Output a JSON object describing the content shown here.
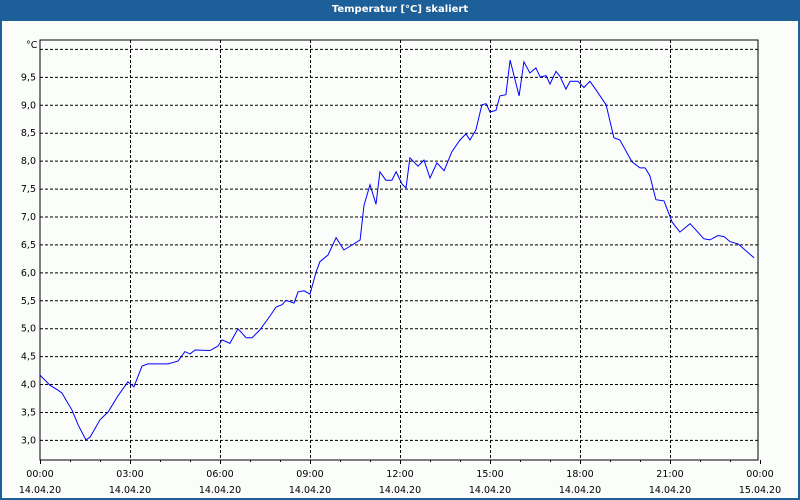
{
  "window": {
    "title": "Temperatur [°C] skaliert"
  },
  "colors": {
    "titlebar": "#1d5f98",
    "line": "#0000ff",
    "grid": "#000000"
  },
  "chart_data": {
    "type": "line",
    "title": "Temperatur [°C] skaliert",
    "ylabel": "°C",
    "xlabel": "",
    "ylim": [
      2.64,
      10.16
    ],
    "xlim_hours": [
      0,
      24
    ],
    "y_gridlines": [
      3.0,
      3.5,
      4.0,
      4.5,
      5.0,
      5.5,
      6.0,
      6.5,
      7.0,
      7.5,
      8.0,
      8.5,
      9.0,
      9.5,
      10.0
    ],
    "y_ticks": [
      "3,0",
      "3,5",
      "4,0",
      "4,5",
      "5,0",
      "5,5",
      "6,0",
      "6,5",
      "7,0",
      "7,5",
      "8,0",
      "8,5",
      "9,0",
      "9,5"
    ],
    "y_tick_values": [
      3.0,
      3.5,
      4.0,
      4.5,
      5.0,
      5.5,
      6.0,
      6.5,
      7.0,
      7.5,
      8.0,
      8.5,
      9.0,
      9.5
    ],
    "x_ticks": [
      {
        "hour": 0,
        "time": "00:00",
        "date": "14.04.20"
      },
      {
        "hour": 3,
        "time": "03:00",
        "date": "14.04.20"
      },
      {
        "hour": 6,
        "time": "06:00",
        "date": "14.04.20"
      },
      {
        "hour": 9,
        "time": "09:00",
        "date": "14.04.20"
      },
      {
        "hour": 12,
        "time": "12:00",
        "date": "14.04.20"
      },
      {
        "hour": 15,
        "time": "15:00",
        "date": "14.04.20"
      },
      {
        "hour": 18,
        "time": "18:00",
        "date": "14.04.20"
      },
      {
        "hour": 21,
        "time": "21:00",
        "date": "14.04.20"
      },
      {
        "hour": 24,
        "time": "00:00",
        "date": "15.04.20"
      }
    ],
    "grid": true,
    "series": [
      {
        "name": "Temperatur",
        "x_hours": [
          0,
          0.33,
          0.6,
          0.73,
          1.07,
          1.27,
          1.53,
          1.67,
          2.0,
          2.27,
          2.6,
          2.93,
          3.13,
          3.4,
          3.6,
          4.27,
          4.6,
          4.83,
          5.0,
          5.17,
          5.67,
          5.93,
          6.07,
          6.33,
          6.6,
          6.87,
          7.07,
          7.33,
          7.67,
          7.87,
          8.07,
          8.2,
          8.47,
          8.6,
          8.8,
          9.0,
          9.2,
          9.33,
          9.6,
          9.87,
          10.13,
          10.4,
          10.67,
          10.8,
          11.0,
          11.2,
          11.33,
          11.53,
          11.73,
          11.87,
          12.07,
          12.2,
          12.33,
          12.6,
          12.8,
          13.0,
          13.23,
          13.47,
          13.73,
          14.0,
          14.2,
          14.33,
          14.53,
          14.73,
          14.87,
          15.0,
          15.2,
          15.33,
          15.53,
          15.67,
          15.97,
          16.13,
          16.33,
          16.53,
          16.67,
          16.87,
          17.0,
          17.2,
          17.33,
          17.53,
          17.67,
          17.93,
          18.13,
          18.33,
          18.53,
          18.87,
          19.13,
          19.33,
          19.73,
          20.0,
          20.17,
          20.33,
          20.53,
          20.8,
          21.07,
          21.33,
          21.67,
          22.13,
          22.33,
          22.6,
          22.8,
          23.0,
          23.27,
          23.8
        ],
        "values": [
          4.16,
          3.98,
          3.89,
          3.84,
          3.53,
          3.27,
          3.0,
          3.05,
          3.36,
          3.5,
          3.79,
          4.04,
          3.95,
          4.32,
          4.36,
          4.36,
          4.41,
          4.58,
          4.54,
          4.61,
          4.6,
          4.68,
          4.79,
          4.73,
          4.99,
          4.83,
          4.83,
          4.97,
          5.22,
          5.38,
          5.42,
          5.5,
          5.45,
          5.65,
          5.67,
          5.61,
          6.0,
          6.19,
          6.31,
          6.62,
          6.4,
          6.49,
          6.58,
          7.2,
          7.57,
          7.22,
          7.8,
          7.65,
          7.65,
          7.8,
          7.58,
          7.51,
          8.05,
          7.9,
          8.01,
          7.69,
          7.96,
          7.82,
          8.16,
          8.37,
          8.48,
          8.37,
          8.55,
          9.0,
          9.02,
          8.87,
          8.9,
          9.16,
          9.18,
          9.8,
          9.16,
          9.77,
          9.57,
          9.66,
          9.5,
          9.52,
          9.37,
          9.6,
          9.51,
          9.28,
          9.42,
          9.42,
          9.31,
          9.42,
          9.27,
          9.0,
          8.41,
          8.37,
          7.98,
          7.87,
          7.87,
          7.73,
          7.3,
          7.28,
          6.9,
          6.72,
          6.87,
          6.6,
          6.58,
          6.66,
          6.64,
          6.55,
          6.51,
          6.26
        ]
      }
    ]
  }
}
